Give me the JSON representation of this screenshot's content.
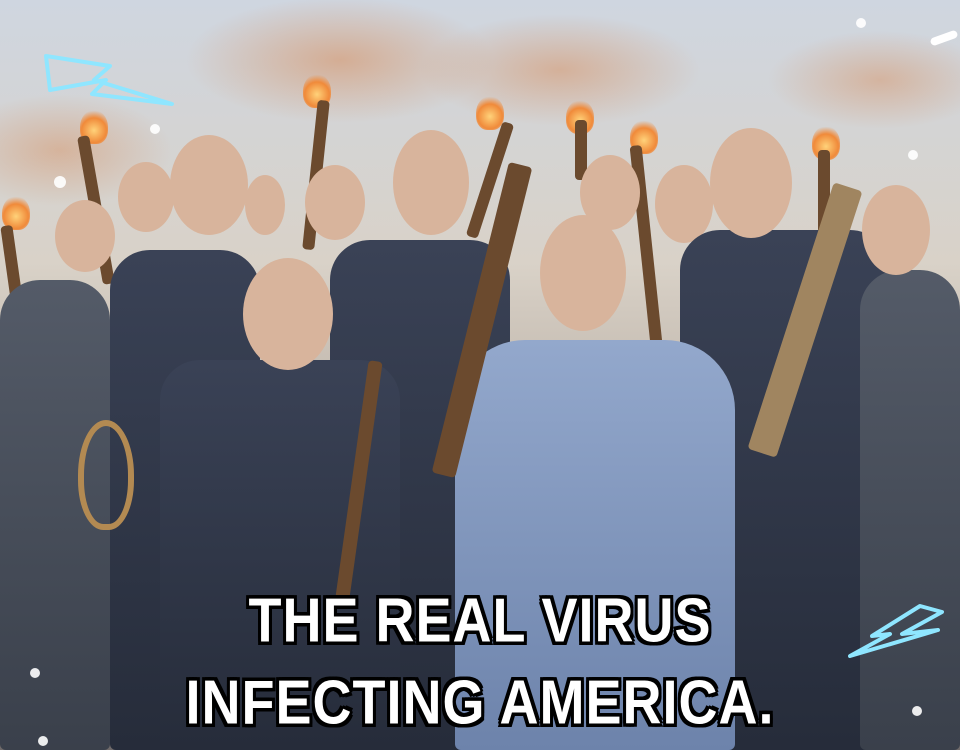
{
  "caption": {
    "line1": "THE REAL VIRUS",
    "line2": "INFECTING AMERICA."
  },
  "icons": {
    "top_left": "lightning-bolt-outline-icon",
    "bottom_right": "lightning-bolt-outline-icon"
  },
  "colors": {
    "caption_fill": "#ffffff",
    "caption_stroke": "#000000",
    "bolt_outline": "#8fe6ff",
    "flame": "#f08a3a"
  }
}
